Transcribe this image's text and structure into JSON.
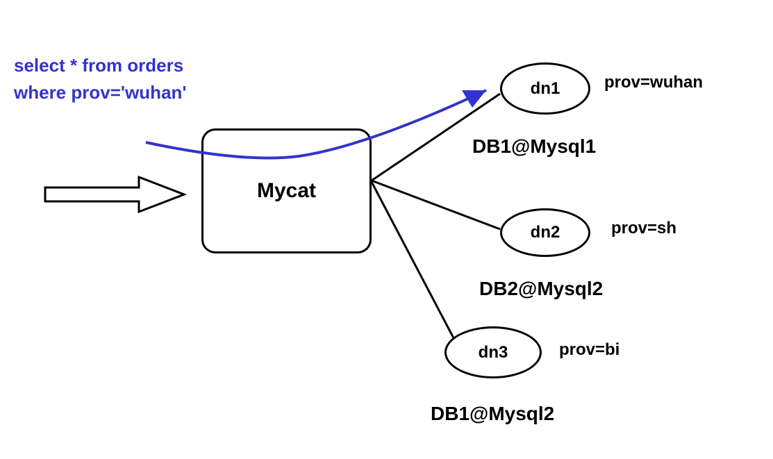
{
  "query": {
    "line1": "select * from orders",
    "line2": "where prov='wuhan'"
  },
  "middleware": {
    "label": "Mycat"
  },
  "nodes": [
    {
      "id": "dn1",
      "prov": "prov=wuhan",
      "db": "DB1@Mysql1"
    },
    {
      "id": "dn2",
      "prov": "prov=sh",
      "db": "DB2@Mysql2"
    },
    {
      "id": "dn3",
      "prov": "prov=bi",
      "db": "DB1@Mysql2"
    }
  ]
}
